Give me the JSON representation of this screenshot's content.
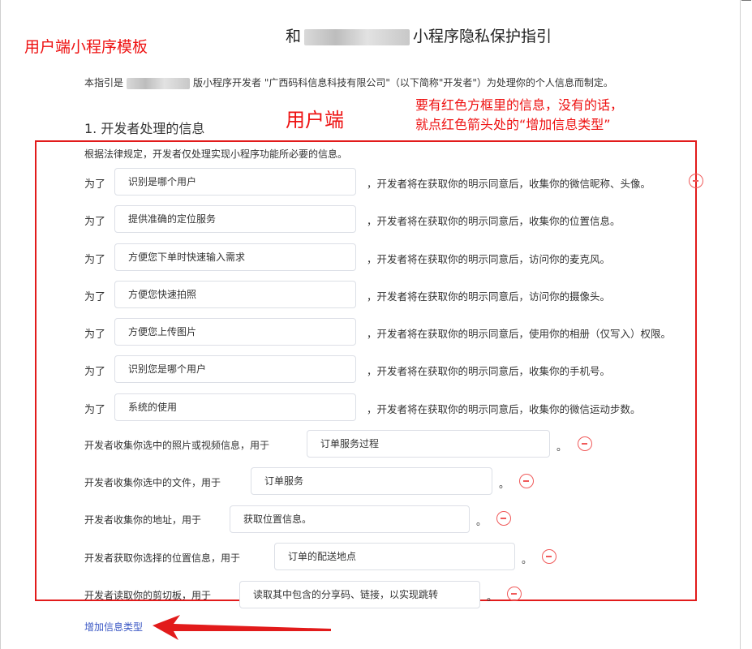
{
  "title": {
    "prefix": "和",
    "suffix": "小程序隐私保护指引"
  },
  "annotations": {
    "top_left": "用户端小程序模板",
    "user_side": "用户端",
    "instruction_1": "要有红色方框里的信息，没有的话，",
    "instruction_2": "就点红色箭头处的“增加信息类型”"
  },
  "intro": {
    "prefix": "本指引是",
    "mid": "版小程序开发者 \"广西码科信息科技有限公司\"（以下简称\"开发者\"）为处理你的个人信息而制定。"
  },
  "section_title": "1. 开发者处理的信息",
  "legal_note": "根据法律规定，开发者仅处理实现小程序功能所必要的信息。",
  "purpose_prefix": "为了",
  "purposes": [
    {
      "value": "识别是哪个用户",
      "suffix": "，开发者将在获取你的明示同意后，收集你的微信昵称、头像。"
    },
    {
      "value": "提供准确的定位服务",
      "suffix": "，开发者将在获取你的明示同意后，收集你的位置信息。"
    },
    {
      "value": "方便您下单时快速输入需求",
      "suffix": "，开发者将在获取你的明示同意后，访问你的麦克风。"
    },
    {
      "value": "方便您快速拍照",
      "suffix": "，开发者将在获取你的明示同意后，访问你的摄像头。"
    },
    {
      "value": "方便您上传图片",
      "suffix": "，开发者将在获取你的明示同意后，使用你的相册（仅写入）权限。"
    },
    {
      "value": "识别您是哪个用户",
      "suffix": "，开发者将在获取你的明示同意后，收集你的手机号。"
    },
    {
      "value": "系统的使用",
      "suffix": "，开发者将在获取你的明示同意后，收集你的微信运动步数。"
    }
  ],
  "collections": [
    {
      "prefix": "开发者收集你选中的照片或视频信息，用于",
      "value": "订单服务过程",
      "end": "。"
    },
    {
      "prefix": "开发者收集你选中的文件，用于",
      "value": "订单服务",
      "end": "。"
    },
    {
      "prefix": "开发者收集你的地址，用于",
      "value": "获取位置信息。",
      "end": "。"
    },
    {
      "prefix": "开发者获取你选择的位置信息，用于",
      "value": "订单的配送地点",
      "end": "。"
    },
    {
      "prefix": "开发者读取你的剪切板，用于",
      "value": "读取其中包含的分享码、链接，以实现跳转",
      "end": "。"
    }
  ],
  "add_info_type": "增加信息类型",
  "colors": {
    "annotation_red": "#e21b1b",
    "minus_red": "#f05a5a",
    "link_blue": "#3a57c4",
    "border": "#dcdfe6"
  },
  "icons": {
    "remove": "minus-circle-icon",
    "arrow": "red-arrow-icon"
  }
}
